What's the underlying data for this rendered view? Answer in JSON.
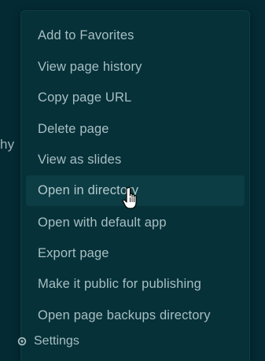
{
  "background": {
    "partial_text": "hy"
  },
  "menu": {
    "items": [
      {
        "label": "Add to Favorites"
      },
      {
        "label": "View page history"
      },
      {
        "label": "Copy page URL"
      },
      {
        "label": "Delete page"
      },
      {
        "label": "View as slides"
      },
      {
        "label": "Open in directory",
        "hovered": true
      },
      {
        "label": "Open with default app"
      },
      {
        "label": "Export page"
      },
      {
        "label": "Make it public for publishing"
      },
      {
        "label": "Open page backups directory"
      }
    ],
    "footer": {
      "label": "Settings",
      "icon": "gear-icon"
    }
  },
  "colors": {
    "background": "#042a33",
    "menu_background": "#063139",
    "hover_background": "#0c3c44",
    "text": "#a8bfc2"
  }
}
